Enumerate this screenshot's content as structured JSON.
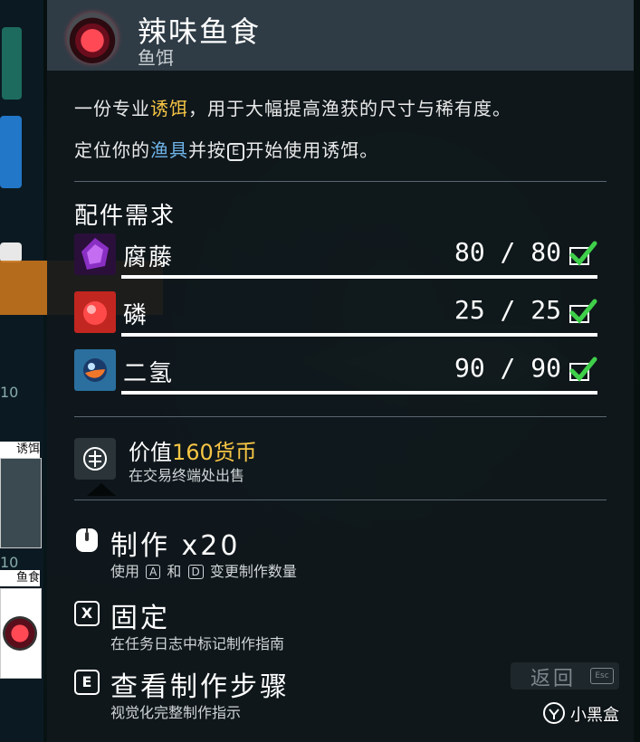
{
  "item": {
    "title": "辣味鱼食",
    "subtitle": "鱼饵"
  },
  "description": {
    "line1_pre": "一份专业",
    "line1_hl": "诱饵",
    "line1_post": "，用于大幅提高渔获的尺寸与稀有度。",
    "line2_pre": "定位你的",
    "line2_hl": "渔具",
    "line2_mid": "并按",
    "line2_key": "E",
    "line2_post": "开始使用诱饵。"
  },
  "requirements": {
    "title": "配件需求",
    "items": [
      {
        "name": "腐藤",
        "have": 80,
        "need": 80,
        "count_text": "80 / 80",
        "icon": "rotten-vine-icon",
        "color": "#8a2fc4"
      },
      {
        "name": "磷",
        "have": 25,
        "need": 25,
        "count_text": "25 / 25",
        "icon": "phosphorus-icon",
        "color": "#e2332d"
      },
      {
        "name": "二氢",
        "have": 90,
        "need": 90,
        "count_text": "90 / 90",
        "icon": "dihydrogen-icon",
        "color": "#3b9ad0"
      }
    ]
  },
  "value": {
    "label": "价值",
    "amount": "160货币",
    "sub": "在交易终端处出售",
    "icon": "units-currency-icon"
  },
  "actions": [
    {
      "label": "制作 x20",
      "sub_pre": "使用",
      "key_a": "A",
      "sub_mid": "和",
      "key_b": "D",
      "sub_post": "变更制作数量",
      "icon": "mouse-icon"
    },
    {
      "label": "固定",
      "sub": "在任务日志中标记制作指南",
      "key": "X"
    },
    {
      "label": "查看制作步骤",
      "sub": "视觉化完整制作指示",
      "key": "E"
    }
  ],
  "back": {
    "label": "返回",
    "key": "Esc"
  },
  "background": {
    "card1_label": "诱饵",
    "card2_label": "鱼食",
    "number": "10"
  },
  "watermark": {
    "text": "小黑盒"
  },
  "colors": {
    "accent_yellow": "#f6c544",
    "accent_blue": "#6fb4e8",
    "check_green": "#3fcf4a",
    "header_bg": "#2f3c46"
  }
}
